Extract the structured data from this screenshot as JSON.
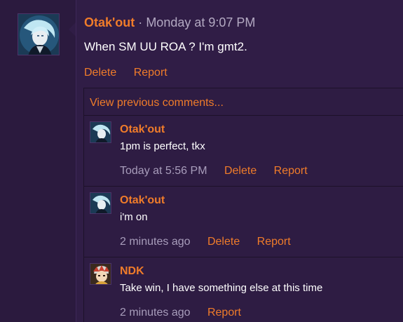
{
  "post": {
    "author": "Otak'out",
    "separator": "·",
    "date": "Monday at 9:07 PM",
    "message": "When SM UU ROA ? I'm gmt2.",
    "actions": {
      "delete": "Delete",
      "report": "Report"
    }
  },
  "comments": {
    "view_previous": "View previous comments...",
    "items": [
      {
        "author": "Otak'out",
        "text": "1pm is perfect, tkx",
        "time": "Today at 5:56 PM",
        "delete": "Delete",
        "report": "Report"
      },
      {
        "author": "Otak'out",
        "text": "i'm on",
        "time": "2 minutes ago",
        "delete": "Delete",
        "report": "Report"
      },
      {
        "author": "NDK",
        "text": "Take win, I have something else at this time",
        "time": "2 minutes ago",
        "report": "Report"
      }
    ]
  },
  "colors": {
    "accent": "#f07c2a",
    "background": "#2b1a3e",
    "panel": "#301d46",
    "muted": "#a89dbb"
  }
}
